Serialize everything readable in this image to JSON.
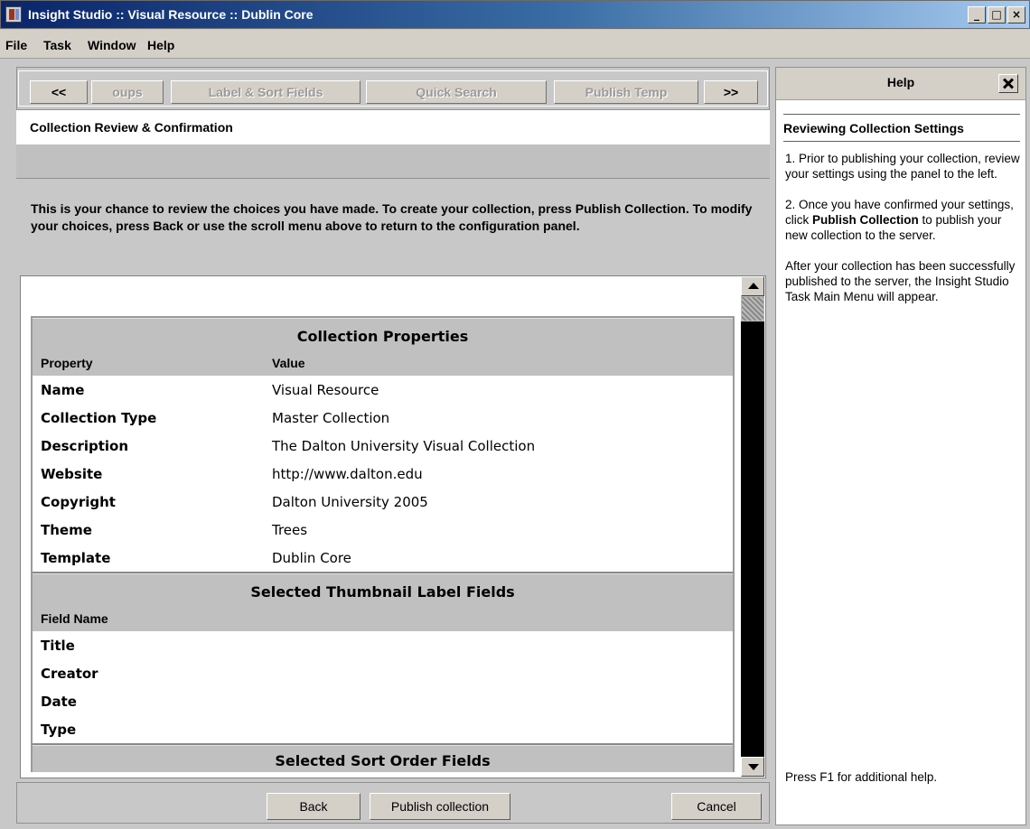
{
  "window": {
    "title": "Insight Studio :: Visual Resource :: Dublin Core",
    "minimize": "_",
    "maximize": "□",
    "close": "×"
  },
  "menu": {
    "file": "File",
    "task": "Task",
    "window": "Window",
    "help": "Help"
  },
  "nav": {
    "prev": "<<",
    "groups": "oups",
    "label_sort": "Label & Sort Fields",
    "quick_search": "Quick Search",
    "publish_temp": "Publish Temp",
    "next": ">>"
  },
  "section_title": "Collection Review & Confirmation",
  "intro_text": "This is your chance to review the choices you have made.  To create your collection, press Publish Collection.  To modify your choices, press Back or use the scroll menu above to return to the configuration panel.",
  "collection_properties": {
    "title": "Collection Properties",
    "col_property": "Property",
    "col_value": "Value",
    "rows": [
      {
        "key": "Name",
        "value": "Visual Resource"
      },
      {
        "key": "Collection Type",
        "value": "Master Collection"
      },
      {
        "key": "Description",
        "value": "The Dalton University Visual Collection"
      },
      {
        "key": "Website",
        "value": "http://www.dalton.edu"
      },
      {
        "key": "Copyright",
        "value": "Dalton University 2005"
      },
      {
        "key": "Theme",
        "value": "Trees"
      },
      {
        "key": "Template",
        "value": "Dublin Core"
      }
    ]
  },
  "thumbnail_fields": {
    "title": "Selected Thumbnail Label Fields",
    "col_field": "Field Name",
    "rows": [
      "Title",
      "Creator",
      "Date",
      "Type"
    ]
  },
  "sort_fields": {
    "title": "Selected Sort Order Fields"
  },
  "buttons": {
    "back": "Back",
    "publish": "Publish collection",
    "cancel": "Cancel"
  },
  "help": {
    "header": "Help",
    "title": "Reviewing Collection Settings",
    "p1": "1. Prior to publishing your collection, review your settings using the panel to the left.",
    "p2_pre": "2. Once you have confirmed your settings, click ",
    "p2_bold": "Publish Collection",
    "p2_post": " to publish your new collection to the server.",
    "p3": "After your collection has been successfully published to the server, the Insight Studio Task Main Menu will appear.",
    "footer": "Press F1 for additional help."
  }
}
